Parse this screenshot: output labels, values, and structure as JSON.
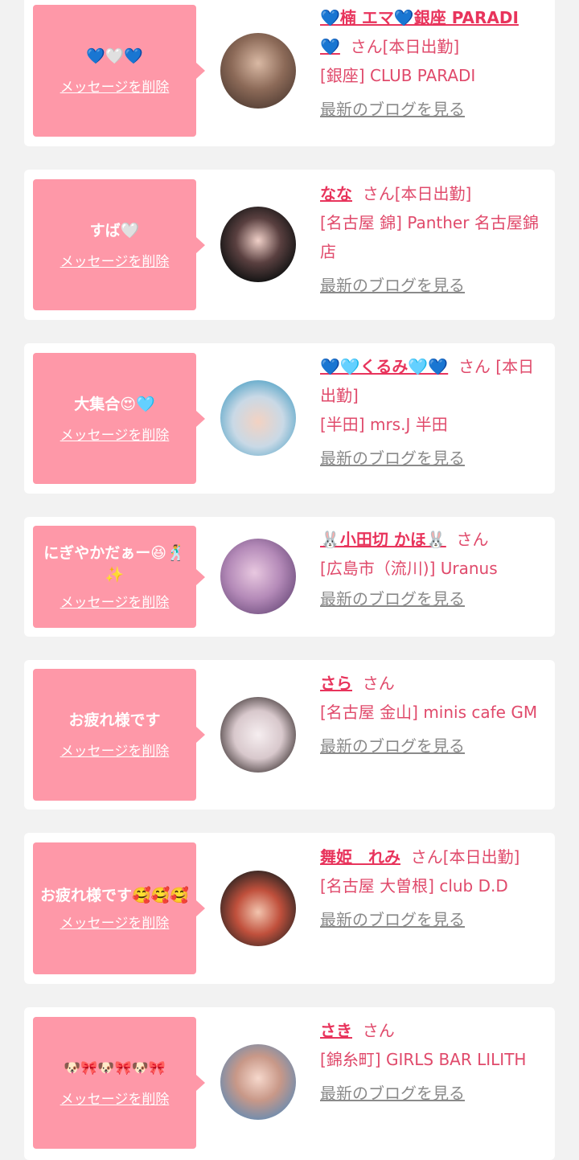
{
  "delete_label": "メッセージを削除",
  "blog_label": "最新のブログを見る",
  "honorific": "さん",
  "cards": [
    {
      "message": "💙🤍💙",
      "name": "💙楠 エマ💙銀座 PARADI💙",
      "status": "[本日出勤]",
      "shop": "[銀座] CLUB PARADI"
    },
    {
      "message": "すば🤍",
      "name": "なな",
      "status": "[本日出勤]",
      "shop": "[名古屋 錦] Panther 名古屋錦店"
    },
    {
      "message": "大集合😍🩵",
      "name": "💙🩵くるみ🩵💙",
      "status": "[本日出勤]",
      "shop": "[半田] mrs.J 半田"
    },
    {
      "message": "にぎやかだぁー😆🕺✨",
      "name": "🐰小田切 かほ🐰",
      "status": "",
      "shop": "[広島市（流川)] Uranus"
    },
    {
      "message": "お疲れ様です",
      "name": "さら",
      "status": "",
      "shop": "[名古屋 金山] minis cafe GM"
    },
    {
      "message": "お疲れ様です🥰🥰🥰",
      "name": "舞姫　れみ",
      "status": "[本日出勤]",
      "shop": "[名古屋 大曽根] club D.D"
    },
    {
      "message": "🐶🎀🐶🎀🐶🎀",
      "name": "さき",
      "status": "",
      "shop": "[錦糸町] GIRLS BAR LILITH"
    }
  ],
  "colors": {
    "page_bg": "#f2f2f2",
    "card_bg": "#ffffff",
    "bubble_bg": "#fe98a8",
    "name_color": "#e8345c",
    "text_color": "#e04a6b",
    "link_gray": "#8a8a8a"
  }
}
